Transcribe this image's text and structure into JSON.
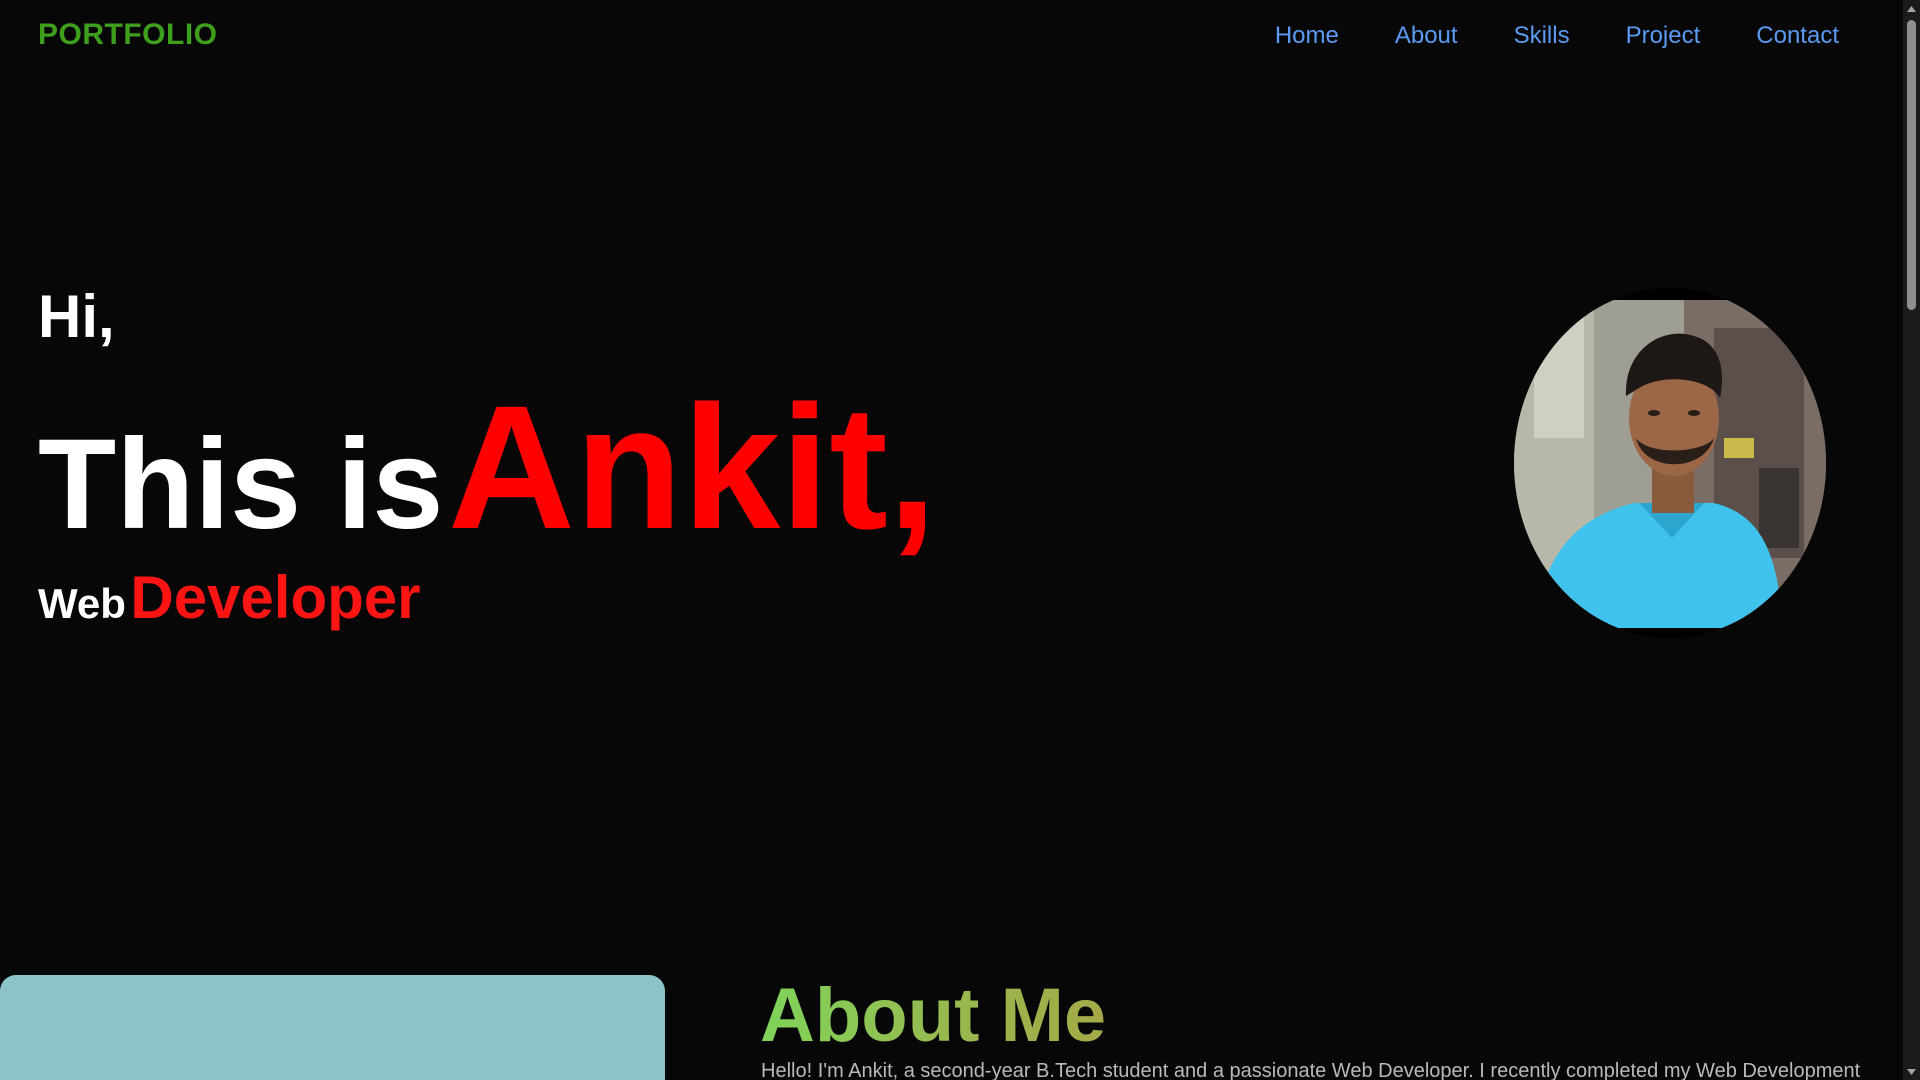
{
  "header": {
    "brand": "PORTFOLIO",
    "nav": [
      "Home",
      "About",
      "Skills",
      "Project",
      "Contact"
    ]
  },
  "hero": {
    "greeting": "Hi,",
    "intro": "This is",
    "name": "Ankit,",
    "role_prefix": "Web",
    "role": "Developer"
  },
  "about": {
    "title": "About Me",
    "text": "Hello! I'm Ankit, a second-year B.Tech student and a passionate Web Developer. I recently completed my Web Development"
  },
  "icons": [
    "profile-photo",
    "scroll-up-arrow-icon",
    "scroll-down-arrow-icon"
  ],
  "colors": {
    "background": "#070708",
    "brand": "#3e9f1c",
    "nav_link": "#5b9af1",
    "name_accent": "#ff0000",
    "about_card": "#8ac3c9"
  }
}
